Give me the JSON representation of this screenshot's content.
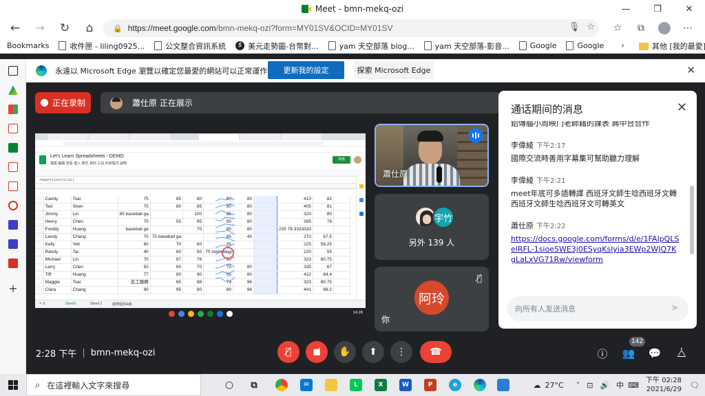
{
  "window": {
    "title": "Meet - bmn-mekq-ozi",
    "controls": [
      "—",
      "❐",
      "✕"
    ]
  },
  "browser": {
    "url_host": "https://meet.google.com",
    "url_path": "/bmn-mekq-ozi?form=MY01SV&OCID=MY01SV",
    "bookmarks": [
      "Bookmarks",
      "收件匣 - liling0925...",
      "公文整合資訊系統",
      "美元走勢圖-台幣對...",
      "yam 天空部落 blog...",
      "yam 天空部落-影音...",
      "Google",
      "Google"
    ],
    "other_bookmarks": "其他 [我的最愛]"
  },
  "infobar": {
    "message": "永遠以 Microsoft Edge 瀏覽以確定您最愛的網站可以正常運作",
    "primary_button": "更新我的設定",
    "secondary_button": "探索 Microsoft Edge"
  },
  "meet": {
    "recording_label": "正在录制",
    "presenter_label": "蕭仕原 正在展示",
    "self_tile_name": "蕭仕原",
    "others_avatar_text": "宇竹",
    "others_count_label": "另外 139 人",
    "you_avatar_text": "阿玲",
    "you_label": "你",
    "time": "2:28 下午",
    "separator": "|",
    "meeting_code": "bmn-mekq-ozi",
    "participants_badge": "142"
  },
  "screen_share": {
    "doc_title": "Let's Learn Spreadsheets - DEMO",
    "menus": "檔案 編輯 查看 插入 格式 資料 工具 外掛程式 說明",
    "share_button": "共用",
    "formula": "=sparkline(C2:G2)",
    "sheet_tabs": [
      "Sheet1",
      "Sheet 2",
      "換學組別A組"
    ],
    "clock": "14:28",
    "rows": [
      {
        "r": "6",
        "first": "Candy",
        "last": "Tsai",
        "c": "75",
        "d": "85",
        "e": "80",
        "f": "90",
        "g": "80",
        "i": "410",
        "j": "82"
      },
      {
        "r": "7",
        "first": "Ted",
        "last": "Shen",
        "c": "70",
        "d": "80",
        "e": "85",
        "f": "90",
        "g": "80",
        "i": "405",
        "j": "81"
      },
      {
        "r": "8",
        "first": "Jimmy",
        "last": "Lin",
        "c": "85 baseball ga",
        "d": "",
        "e": "100",
        "f": "85",
        "g": "80",
        "i": "320",
        "j": "80"
      },
      {
        "r": "9",
        "first": "Henry",
        "last": "Chen",
        "c": "70",
        "d": "55",
        "e": "95",
        "f": "90",
        "g": "80",
        "i": "395",
        "j": "79"
      },
      {
        "r": "10",
        "first": "Freddy",
        "last": "Huang",
        "c": "baseball ga",
        "d": "",
        "e": "70",
        "f": "85",
        "g": "80",
        "i": "235 78.3333333",
        "j": ""
      },
      {
        "r": "11",
        "first": "Landy",
        "last": "Chang",
        "c": "70",
        "d": "75 baseball ga",
        "e": "",
        "f": "85",
        "g": "40",
        "i": "270",
        "j": "67.5"
      },
      {
        "r": "12",
        "first": "Kelly",
        "last": "Yeh",
        "c": "60",
        "d": "70",
        "e": "60",
        "f": "35",
        "g": "",
        "i": "225",
        "j": "56.25"
      },
      {
        "r": "13",
        "first": "Randy",
        "last": "Tai",
        "c": "40",
        "d": "60",
        "e": "50",
        "f": "70 swimming",
        "g": "",
        "i": "220",
        "j": "55"
      },
      {
        "r": "14",
        "first": "Michael",
        "last": "Lin",
        "c": "70",
        "d": "87",
        "e": "76",
        "f": "90",
        "g": "",
        "i": "323",
        "j": "80.75"
      },
      {
        "r": "15",
        "first": "Larry",
        "last": "Chen",
        "c": "50",
        "d": "60",
        "e": "70",
        "f": "75",
        "g": "80",
        "i": "335",
        "j": "67"
      },
      {
        "r": "16",
        "first": "Tiff",
        "last": "Huang",
        "c": "77",
        "d": "80",
        "e": "90",
        "f": "95",
        "g": "80",
        "i": "422",
        "j": "84.4"
      },
      {
        "r": "17",
        "first": "Maggie",
        "last": "Tsai",
        "c": "志工服務",
        "d": "65",
        "e": "88",
        "f": "74",
        "g": "96",
        "i": "323",
        "j": "80.75"
      },
      {
        "r": "18",
        "first": "Clara",
        "last": "Chang",
        "c": "90",
        "d": "95",
        "e": "80",
        "f": "80",
        "g": "96",
        "i": "441",
        "j": "88.2"
      }
    ]
  },
  "chat": {
    "title": "通话期间的消息",
    "truncated_top": "鋁傳腦小周映门老師藉的課表 典中台合作",
    "messages": [
      {
        "sender": "李偉綾",
        "time": "下午2:17",
        "text": "國際交流時善用字幕集可幫助聽力理解",
        "link": false
      },
      {
        "sender": "李偉綾",
        "time": "下午2:21",
        "text": "meet年底可多語轉譯 西班牙文師生唸西班牙文轉西班牙文師生唸西班牙文可轉英文",
        "link": false
      },
      {
        "sender": "蕭仕原",
        "time": "下午2:22",
        "text": "https://docs.google.com/forms/d/e/1FAIpQLSelRFL-1sioeSWE3j0ESyqKslyia3EWp2WJQ7KgLaLxVG71Rw/viewform",
        "link": true
      }
    ],
    "input_placeholder": "向所有人发送消息"
  },
  "taskbar": {
    "search_placeholder": "在這裡輸入文字來搜尋",
    "weather": "27°C",
    "ime": "中",
    "time": "下午 02:28",
    "date": "2021/6/29"
  },
  "colors": {
    "meet_bg": "#202124",
    "record_red": "#d93025",
    "edge_blue": "#0f6cbd",
    "active_border": "#8ab4f8"
  }
}
